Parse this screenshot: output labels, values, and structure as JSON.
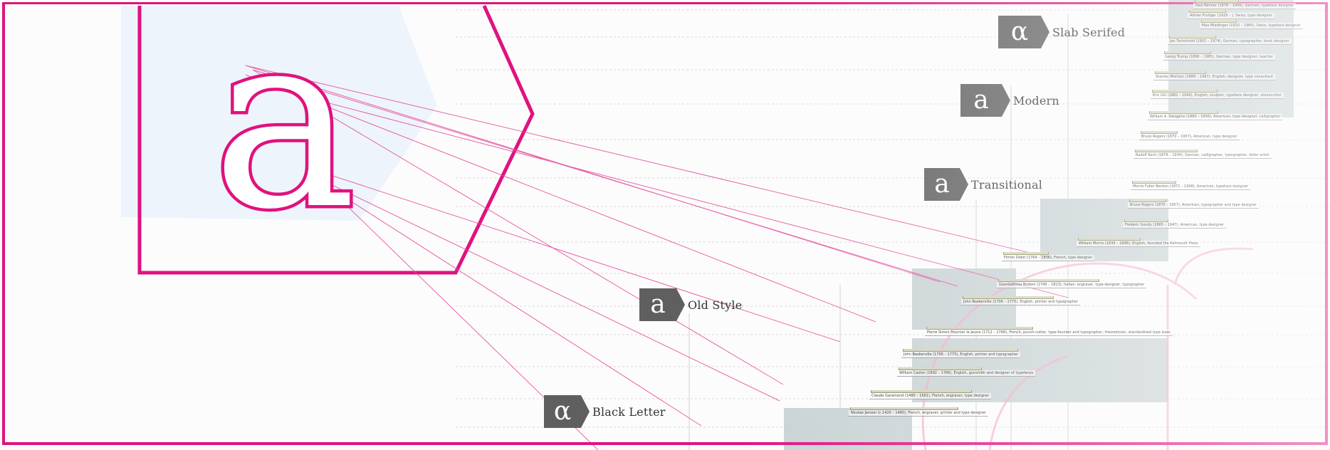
{
  "hero": {
    "glyph": "a"
  },
  "categories": [
    {
      "id": "slab",
      "glyph": "α",
      "label": "Slab Serifed"
    },
    {
      "id": "modern",
      "glyph": "a",
      "label": "Modern"
    },
    {
      "id": "transitional",
      "glyph": "a",
      "label": "Transitional"
    },
    {
      "id": "oldstyle",
      "glyph": "a",
      "label": "Old Style"
    },
    {
      "id": "blackletter",
      "glyph": "α",
      "label": "Black Letter"
    }
  ],
  "colors": {
    "accent": "#e0127f",
    "panel": "#eef4fb",
    "badge": "#5f5f5f",
    "band": "#bfcbcd"
  },
  "timeline": [
    {
      "text": "Paul Renner (1878 – 1956), German, typeface designer"
    },
    {
      "text": "Adrian Frutiger (1928 – ), Swiss, type designer"
    },
    {
      "text": "Max Miedinger (1910 – 1980), Swiss, typeface designer"
    },
    {
      "text": "Jan Tschichold (1902 – 1974), German, typographer, book designer"
    },
    {
      "text": "Georg Trump (1896 – 1985), German, type designer, teacher"
    },
    {
      "text": "Stanley Morison (1889 – 1967), English, designer, type consultant"
    },
    {
      "text": "Eric Gill (1882 – 1940), English, sculptor, typeface designer, stonecutter"
    },
    {
      "text": "William A. Dwiggins (1880 – 1956), American, type designer, calligrapher"
    },
    {
      "text": "Bruce Rogers (1870 – 1957), American, type designer"
    },
    {
      "text": "Rudolf Koch (1876 – 1934), German, calligrapher, typographer, letter artist"
    },
    {
      "text": "Morris Fuller Benton (1872 – 1948), American, typeface designer"
    },
    {
      "text": "Bruce Rogers (1870 – 1957), American, typographer and type designer"
    },
    {
      "text": "Frederic Goudy (1865 – 1947), American, type designer"
    },
    {
      "text": "William Morris (1834 – 1896), English, founded the Kelmscott Press"
    },
    {
      "text": "Firmin Didot (1764 – 1836), French, type designer"
    },
    {
      "text": "Giambattista Bodoni (1740 – 1813), Italian, engraver, type-designer, typographer"
    },
    {
      "text": "John Baskerville (1706 – 1775), English, printer and typographer"
    },
    {
      "text": "Pierre Simon Fournier le Jeune (1712 – 1768), French, punch-cutter, type-founder and typographer, theoretician, standardized type sizes"
    },
    {
      "text": "John Baskerville (1706 – 1775), English, printer and typographer"
    },
    {
      "text": "William Caslon (1692 – 1766), English, gunsmith and designer of typefaces"
    },
    {
      "text": "Claude Garamond (1480 – 1561), French, engraver, type designer"
    },
    {
      "text": "Nicolas Jenson (c.1420 – 1480), French, engraver, printer and type designer"
    }
  ]
}
